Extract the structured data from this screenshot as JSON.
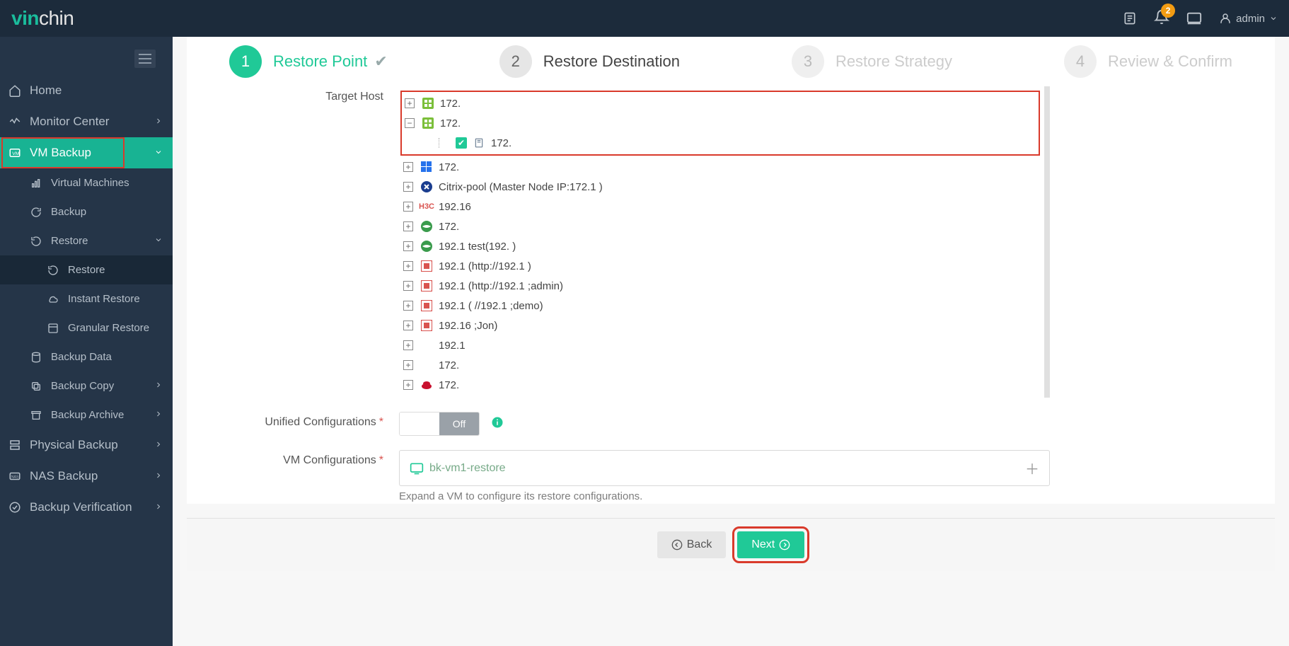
{
  "topbar": {
    "logo_prefix": "vin",
    "logo_suffix": "chin",
    "notification_count": "2",
    "user_label": "admin"
  },
  "sidebar": {
    "items": [
      {
        "label": "Home",
        "icon": "home"
      },
      {
        "label": "Monitor Center",
        "icon": "monitor",
        "chev": true
      },
      {
        "label": "VM Backup",
        "icon": "vm",
        "chev": true,
        "active": true
      },
      {
        "label": "Virtual Machines",
        "icon": "bars",
        "indent": 1
      },
      {
        "label": "Backup",
        "icon": "reload",
        "indent": 1
      },
      {
        "label": "Restore",
        "icon": "restore",
        "indent": 1,
        "chev": true
      },
      {
        "label": "Restore",
        "icon": "restore",
        "indent": 2,
        "selected": true
      },
      {
        "label": "Instant Restore",
        "icon": "cloud",
        "indent": 2
      },
      {
        "label": "Granular Restore",
        "icon": "granular",
        "indent": 2
      },
      {
        "label": "Backup Data",
        "icon": "db",
        "indent": 1
      },
      {
        "label": "Backup Copy",
        "icon": "copy",
        "indent": 1,
        "chev": true
      },
      {
        "label": "Backup Archive",
        "icon": "archive",
        "indent": 1,
        "chev": true
      },
      {
        "label": "Physical Backup",
        "icon": "physical",
        "chev": true
      },
      {
        "label": "NAS Backup",
        "icon": "nas",
        "chev": true
      },
      {
        "label": "Backup Verification",
        "icon": "verify",
        "chev": true
      }
    ]
  },
  "wizard": {
    "steps": [
      {
        "num": "1",
        "label": "Restore Point",
        "state": "done",
        "check": true
      },
      {
        "num": "2",
        "label": "Restore Destination",
        "state": "current"
      },
      {
        "num": "3",
        "label": "Restore Strategy",
        "state": "future"
      },
      {
        "num": "4",
        "label": "Review & Confirm",
        "state": "future"
      }
    ]
  },
  "form": {
    "target_host_label": "Target Host",
    "unified_label": "Unified Configurations",
    "unified_off": "Off",
    "vm_config_label": "VM Configurations",
    "vm_config_value": "bk-vm1-restore",
    "hint": "Expand a VM to configure its restore configurations."
  },
  "tree": {
    "highlighted_children": [
      {
        "label": "172.         ",
        "icon": "vc-green",
        "toggle": "+"
      },
      {
        "label": "172.         ",
        "icon": "vc-green",
        "toggle": "-",
        "children": [
          {
            "label": "172.           ",
            "icon": "host",
            "checked": true
          }
        ]
      }
    ],
    "rest": [
      {
        "label": "172.           ",
        "icon": "windows"
      },
      {
        "label": "Citrix-pool (Master Node IP:172.1      )",
        "icon": "citrix"
      },
      {
        "label": "192.16            ",
        "icon": "h3c"
      },
      {
        "label": "172.       ",
        "icon": "sangfor"
      },
      {
        "label": "192.1        test(192.           )",
        "icon": "sangfor"
      },
      {
        "label": "192.1        (http://192.1            )",
        "icon": "ovirt"
      },
      {
        "label": "192.1        (http://192.1        ;admin)",
        "icon": "ovirt"
      },
      {
        "label": "192.1        (   //192.1        ;demo)",
        "icon": "ovirt"
      },
      {
        "label": "192.16                            ;Jon)",
        "icon": "ovirt"
      },
      {
        "label": "192.1            ",
        "icon": "huawei"
      },
      {
        "label": "172.            ",
        "icon": "huawei"
      },
      {
        "label": "172.       ",
        "icon": "redhat"
      }
    ]
  },
  "footer": {
    "back": "Back",
    "next": "Next"
  }
}
